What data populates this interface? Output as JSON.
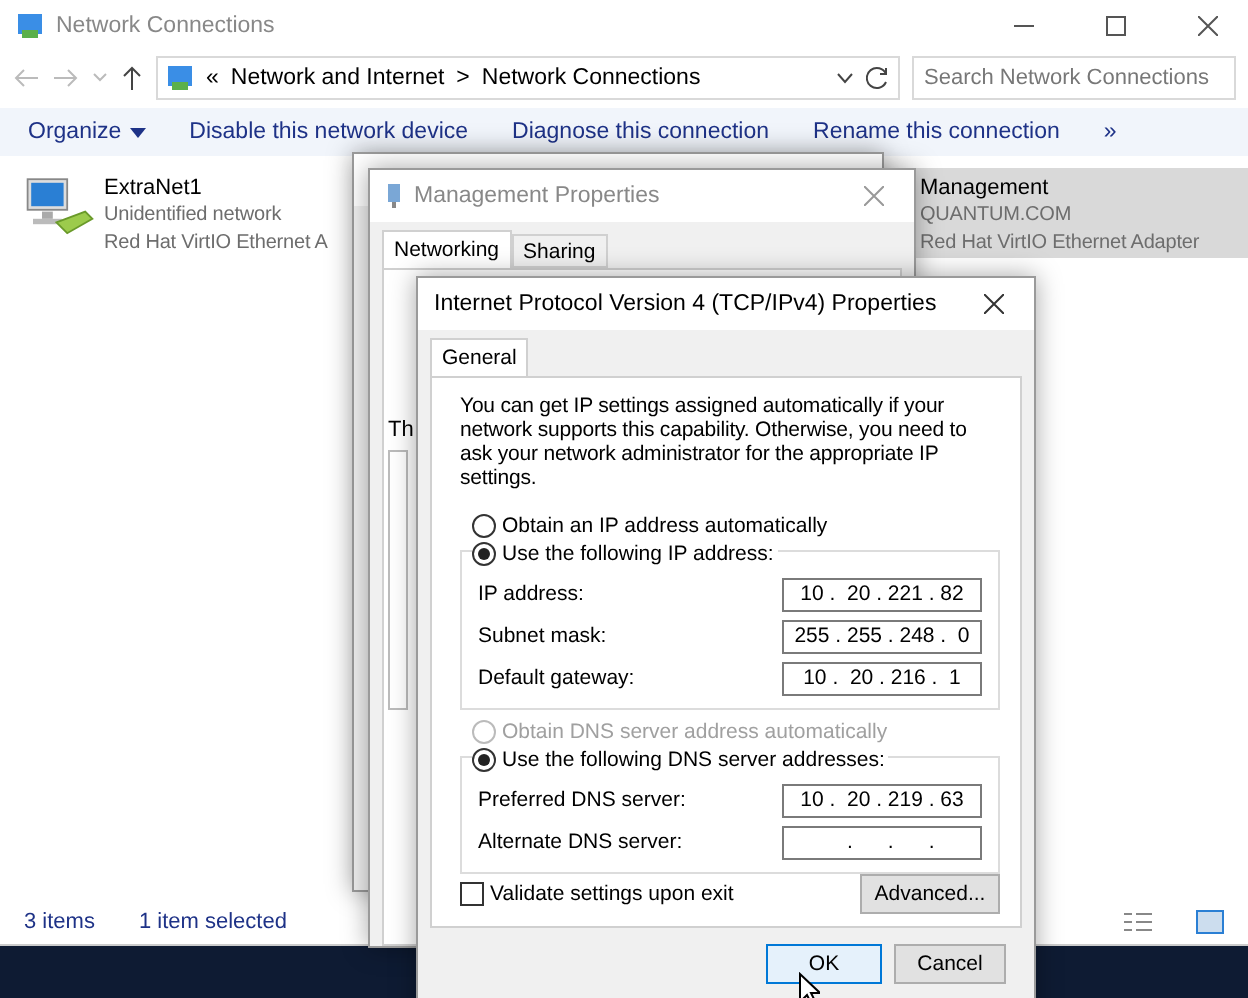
{
  "explorer": {
    "title": "Network Connections",
    "address": {
      "prefix": "«",
      "parts": [
        "Network and Internet",
        "Network Connections"
      ],
      "separator": ">"
    },
    "search": {
      "placeholder": "Search Network Connections"
    },
    "toolbar": [
      {
        "label": "Organize",
        "kind": "menu"
      },
      {
        "label": "Disable this network device",
        "kind": "action"
      },
      {
        "label": "Diagnose this connection",
        "kind": "action"
      },
      {
        "label": "Rename this connection",
        "kind": "action"
      },
      {
        "label": "»",
        "kind": "more"
      }
    ],
    "connections": [
      {
        "name": "ExtraNet1",
        "status": "Unidentified network",
        "device": "Red Hat VirtIO Ethernet A",
        "selected": false
      },
      {
        "name": "Management",
        "status": "QUANTUM.COM",
        "device": "Red Hat VirtIO Ethernet Adapter",
        "selected": true
      }
    ],
    "status_bar": [
      "3 items",
      "1 item selected"
    ]
  },
  "properties_window": {
    "title": "Management Properties",
    "tabs": [
      {
        "label": "Networking",
        "selected": true
      },
      {
        "label": "Sharing",
        "selected": false
      }
    ],
    "fragment": "Th"
  },
  "ipv4_dialog": {
    "title": "Internet Protocol Version 4 (TCP/IPv4) Properties",
    "tabs": [
      {
        "label": "General",
        "selected": true
      }
    ],
    "intro": "You can get IP settings assigned automatically if your network supports this capability. Otherwise, you need to ask your network administrator for the appropriate IP settings.",
    "ip_options": [
      {
        "label": "Obtain an IP address automatically",
        "selected": false,
        "disabled": false
      },
      {
        "label": "Use the following IP address:",
        "selected": true,
        "disabled": false
      }
    ],
    "ip_fields": [
      {
        "label": "IP address:",
        "value": "10 .  20 . 221 . 82"
      },
      {
        "label": "Subnet mask:",
        "value": "255 . 255 . 248 .  0"
      },
      {
        "label": "Default gateway:",
        "value": "10 .  20 . 216 .  1"
      }
    ],
    "dns_options": [
      {
        "label": "Obtain DNS server address automatically",
        "selected": false,
        "disabled": true
      },
      {
        "label": "Use the following DNS server addresses:",
        "selected": true,
        "disabled": false
      }
    ],
    "dns_fields": [
      {
        "label": "Preferred DNS server:",
        "value": "10 .  20 . 219 . 63"
      },
      {
        "label": "Alternate DNS server:",
        "value": "   .      .      ."
      }
    ],
    "validate": {
      "label": "Validate settings upon exit",
      "checked": false
    },
    "advanced": "Advanced...",
    "buttons": [
      {
        "label": "OK",
        "default": true
      },
      {
        "label": "Cancel",
        "default": false
      }
    ]
  }
}
